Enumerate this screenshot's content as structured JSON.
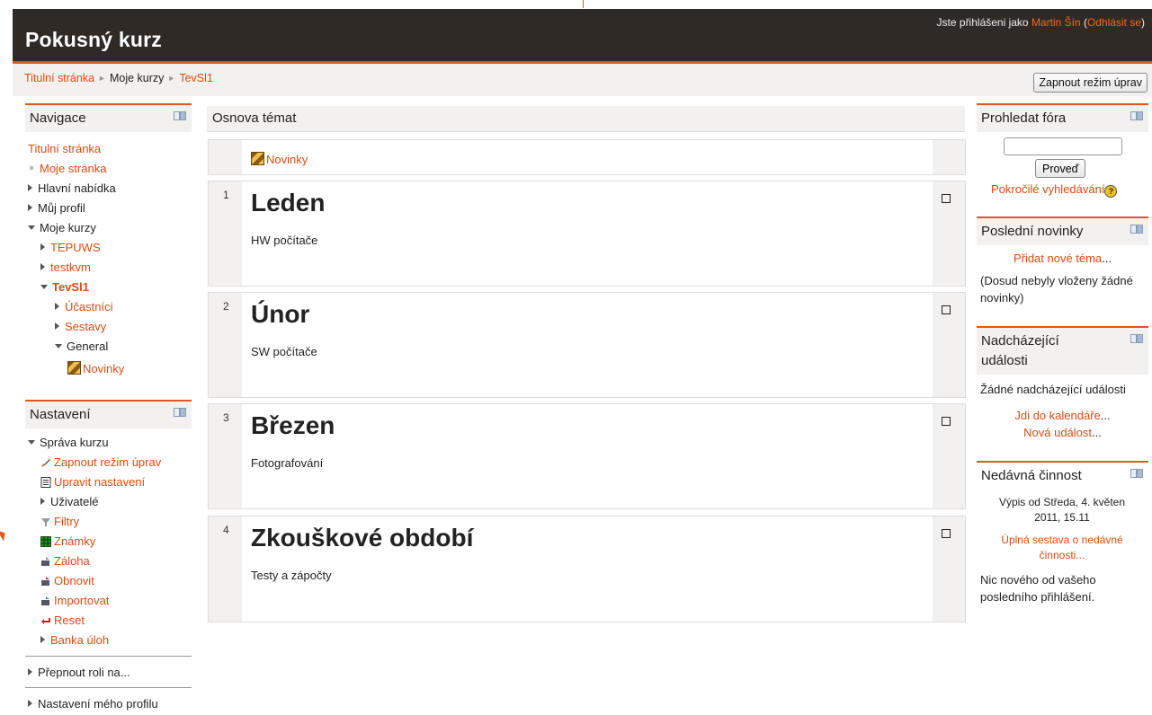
{
  "header": {
    "site_title": "Pokusný kurz",
    "login_prefix": "Jste přihlášeni jako ",
    "user_name": "Martin Šín",
    "logout_open": " (",
    "logout": "Odhlásit se",
    "logout_close": ")"
  },
  "breadcrumb": {
    "home": "Titulní stránka",
    "my_courses": "Moje kurzy",
    "course": "TevSl1",
    "sep": "►"
  },
  "edit_button": "Zapnout režim úprav",
  "navigation": {
    "title": "Navigace",
    "home": "Titulní stránka",
    "my_page": "Moje stránka",
    "main_menu": "Hlavní nabídka",
    "my_profile": "Můj profil",
    "my_courses": "Moje kurzy",
    "course1": "TEPUWS",
    "course2": "testkvm",
    "course3": "TevSl1",
    "participants": "Účastníci",
    "reports": "Sestavy",
    "general": "General",
    "news": "Novinky"
  },
  "settings": {
    "title": "Nastavení",
    "course_admin": "Správa kurzu",
    "edit_mode": "Zapnout režim úprav",
    "edit_settings": "Upravit nastavení",
    "users": "Uživatelé",
    "filters": "Filtry",
    "grades": "Známky",
    "backup": "Záloha",
    "restore": "Obnovit",
    "import": "Importovat",
    "reset": "Reset",
    "question_bank": "Banka úloh",
    "switch_role": "Přepnout roli na...",
    "profile_settings": "Nastavení mého profilu"
  },
  "main": {
    "title": "Osnova témat",
    "news_link": "Novinky",
    "sections": [
      {
        "num": "1",
        "title": "Leden",
        "summary": "HW počítače"
      },
      {
        "num": "2",
        "title": "Únor",
        "summary": "SW počítače"
      },
      {
        "num": "3",
        "title": "Březen",
        "summary": "Fotografování"
      },
      {
        "num": "4",
        "title": "Zkouškové období",
        "summary": "Testy a zápočty"
      }
    ]
  },
  "search_forums": {
    "title": "Prohledat fóra",
    "input_value": "",
    "go": "Proveď",
    "advanced": "Pokročilé vyhledávání"
  },
  "latest_news": {
    "title": "Poslední novinky",
    "add": "Přidat nové téma",
    "add_suffix": "...",
    "empty": "(Dosud nebyly vloženy žádné novinky)"
  },
  "upcoming": {
    "title": "Nadcházející události",
    "none": "Žádné nadcházející události",
    "calendar": "Jdi do kalendáře",
    "new_event": "Nová událost",
    "ellipsis": "..."
  },
  "recent": {
    "title": "Nedávná činnost",
    "since": "Výpis od Středa, 4. květen 2011, 15.11",
    "full_report": "Úplná sestava o nedávné činnosti...",
    "nothing": "Nic nového od vašeho posledního přihlášení."
  },
  "colors": {
    "accent": "#e0581c",
    "header_bg": "#302a26",
    "link": "#dd4b0f"
  }
}
